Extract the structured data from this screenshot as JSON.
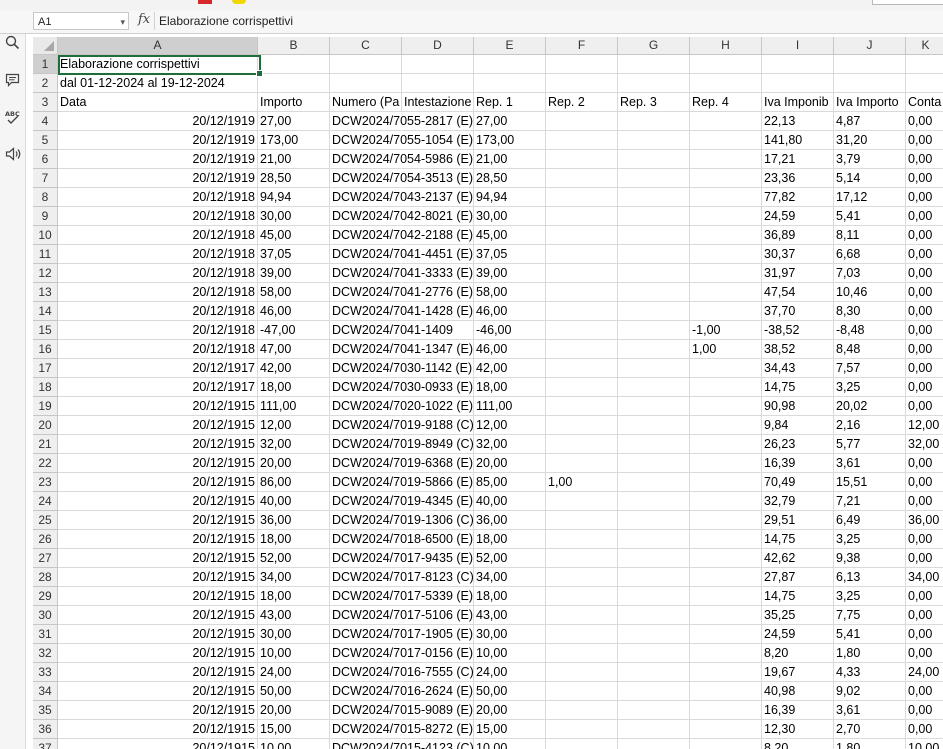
{
  "formula_bar": {
    "name_box": "A1",
    "fx_label": "fx",
    "formula": "Elaborazione corrispettivi"
  },
  "sidebar_icons": [
    "search-icon",
    "comment-icon",
    "spellcheck-icon",
    "speaker-icon"
  ],
  "sidebar_spellcheck_text": "ABC",
  "columns": [
    "A",
    "B",
    "C",
    "D",
    "E",
    "F",
    "G",
    "H",
    "I",
    "J",
    "K"
  ],
  "row_numbers": [
    "1",
    "2",
    "3",
    "4",
    "5",
    "6",
    "7",
    "8",
    "9",
    "10",
    "11",
    "12",
    "13",
    "14",
    "15",
    "16",
    "17",
    "18",
    "19",
    "20",
    "21",
    "22",
    "23",
    "24",
    "25",
    "26",
    "27",
    "28",
    "29",
    "30",
    "31",
    "32",
    "33",
    "34",
    "35",
    "36",
    "37"
  ],
  "title": "Elaborazione corrispettivi",
  "subtitle": "dal 01-12-2024 al 19-12-2024",
  "headers": [
    "Data",
    "Importo",
    "Numero (Pa",
    "Intestazione",
    "Rep. 1",
    "Rep. 2",
    "Rep. 3",
    "Rep. 4",
    "Iva Imponib",
    "Iva Importo",
    "Conta"
  ],
  "rows": [
    [
      "20/12/1919",
      "27,00",
      "DCW2024/7055-2817 (E)",
      "",
      "27,00",
      "",
      "",
      "",
      "22,13",
      "4,87",
      "0,00"
    ],
    [
      "20/12/1919",
      "173,00",
      "DCW2024/7055-1054 (E)",
      "",
      "173,00",
      "",
      "",
      "",
      "141,80",
      "31,20",
      "0,00"
    ],
    [
      "20/12/1919",
      "21,00",
      "DCW2024/7054-5986 (E)",
      "",
      "21,00",
      "",
      "",
      "",
      "17,21",
      "3,79",
      "0,00"
    ],
    [
      "20/12/1919",
      "28,50",
      "DCW2024/7054-3513 (E)",
      "",
      "28,50",
      "",
      "",
      "",
      "23,36",
      "5,14",
      "0,00"
    ],
    [
      "20/12/1918",
      "94,94",
      "DCW2024/7043-2137 (E)",
      "",
      "94,94",
      "",
      "",
      "",
      "77,82",
      "17,12",
      "0,00"
    ],
    [
      "20/12/1918",
      "30,00",
      "DCW2024/7042-8021 (E)",
      "",
      "30,00",
      "",
      "",
      "",
      "24,59",
      "5,41",
      "0,00"
    ],
    [
      "20/12/1918",
      "45,00",
      "DCW2024/7042-2188 (E)",
      "",
      "45,00",
      "",
      "",
      "",
      "36,89",
      "8,11",
      "0,00"
    ],
    [
      "20/12/1918",
      "37,05",
      "DCW2024/7041-4451 (E)",
      "",
      "37,05",
      "",
      "",
      "",
      "30,37",
      "6,68",
      "0,00"
    ],
    [
      "20/12/1918",
      "39,00",
      "DCW2024/7041-3333 (E)",
      "",
      "39,00",
      "",
      "",
      "",
      "31,97",
      "7,03",
      "0,00"
    ],
    [
      "20/12/1918",
      "58,00",
      "DCW2024/7041-2776 (E)",
      "",
      "58,00",
      "",
      "",
      "",
      "47,54",
      "10,46",
      "0,00"
    ],
    [
      "20/12/1918",
      "46,00",
      "DCW2024/7041-1428 (E)",
      "",
      "46,00",
      "",
      "",
      "",
      "37,70",
      "8,30",
      "0,00"
    ],
    [
      "20/12/1918",
      "-47,00",
      "DCW2024/7041-1409",
      "",
      "-46,00",
      "",
      "",
      "-1,00",
      "-38,52",
      "-8,48",
      "0,00"
    ],
    [
      "20/12/1918",
      "47,00",
      "DCW2024/7041-1347 (E)",
      "",
      "46,00",
      "",
      "",
      "1,00",
      "38,52",
      "8,48",
      "0,00"
    ],
    [
      "20/12/1917",
      "42,00",
      "DCW2024/7030-1142 (E)",
      "",
      "42,00",
      "",
      "",
      "",
      "34,43",
      "7,57",
      "0,00"
    ],
    [
      "20/12/1917",
      "18,00",
      "DCW2024/7030-0933 (E)",
      "",
      "18,00",
      "",
      "",
      "",
      "14,75",
      "3,25",
      "0,00"
    ],
    [
      "20/12/1915",
      "111,00",
      "DCW2024/7020-1022 (E)",
      "",
      "111,00",
      "",
      "",
      "",
      "90,98",
      "20,02",
      "0,00"
    ],
    [
      "20/12/1915",
      "12,00",
      "DCW2024/7019-9188 (C)",
      "",
      "12,00",
      "",
      "",
      "",
      "9,84",
      "2,16",
      "12,00"
    ],
    [
      "20/12/1915",
      "32,00",
      "DCW2024/7019-8949 (C)",
      "",
      "32,00",
      "",
      "",
      "",
      "26,23",
      "5,77",
      "32,00"
    ],
    [
      "20/12/1915",
      "20,00",
      "DCW2024/7019-6368 (E)",
      "",
      "20,00",
      "",
      "",
      "",
      "16,39",
      "3,61",
      "0,00"
    ],
    [
      "20/12/1915",
      "86,00",
      "DCW2024/7019-5866 (E)",
      "",
      "85,00",
      "1,00",
      "",
      "",
      "70,49",
      "15,51",
      "0,00"
    ],
    [
      "20/12/1915",
      "40,00",
      "DCW2024/7019-4345 (E)",
      "",
      "40,00",
      "",
      "",
      "",
      "32,79",
      "7,21",
      "0,00"
    ],
    [
      "20/12/1915",
      "36,00",
      "DCW2024/7019-1306 (C)",
      "",
      "36,00",
      "",
      "",
      "",
      "29,51",
      "6,49",
      "36,00"
    ],
    [
      "20/12/1915",
      "18,00",
      "DCW2024/7018-6500 (E)",
      "",
      "18,00",
      "",
      "",
      "",
      "14,75",
      "3,25",
      "0,00"
    ],
    [
      "20/12/1915",
      "52,00",
      "DCW2024/7017-9435 (E)",
      "",
      "52,00",
      "",
      "",
      "",
      "42,62",
      "9,38",
      "0,00"
    ],
    [
      "20/12/1915",
      "34,00",
      "DCW2024/7017-8123 (C)",
      "",
      "34,00",
      "",
      "",
      "",
      "27,87",
      "6,13",
      "34,00"
    ],
    [
      "20/12/1915",
      "18,00",
      "DCW2024/7017-5339 (E)",
      "",
      "18,00",
      "",
      "",
      "",
      "14,75",
      "3,25",
      "0,00"
    ],
    [
      "20/12/1915",
      "43,00",
      "DCW2024/7017-5106 (E)",
      "",
      "43,00",
      "",
      "",
      "",
      "35,25",
      "7,75",
      "0,00"
    ],
    [
      "20/12/1915",
      "30,00",
      "DCW2024/7017-1905 (E)",
      "",
      "30,00",
      "",
      "",
      "",
      "24,59",
      "5,41",
      "0,00"
    ],
    [
      "20/12/1915",
      "10,00",
      "DCW2024/7017-0156 (E)",
      "",
      "10,00",
      "",
      "",
      "",
      "8,20",
      "1,80",
      "0,00"
    ],
    [
      "20/12/1915",
      "24,00",
      "DCW2024/7016-7555 (C)",
      "",
      "24,00",
      "",
      "",
      "",
      "19,67",
      "4,33",
      "24,00"
    ],
    [
      "20/12/1915",
      "50,00",
      "DCW2024/7016-2624 (E)",
      "",
      "50,00",
      "",
      "",
      "",
      "40,98",
      "9,02",
      "0,00"
    ],
    [
      "20/12/1915",
      "20,00",
      "DCW2024/7015-9089 (E)",
      "",
      "20,00",
      "",
      "",
      "",
      "16,39",
      "3,61",
      "0,00"
    ],
    [
      "20/12/1915",
      "15,00",
      "DCW2024/7015-8272 (E)",
      "",
      "15,00",
      "",
      "",
      "",
      "12,30",
      "2,70",
      "0,00"
    ],
    [
      "20/12/1915",
      "10,00",
      "DCW2024/7015-4123 (C)",
      "",
      "10,00",
      "",
      "",
      "",
      "8,20",
      "1,80",
      "10,00"
    ]
  ]
}
